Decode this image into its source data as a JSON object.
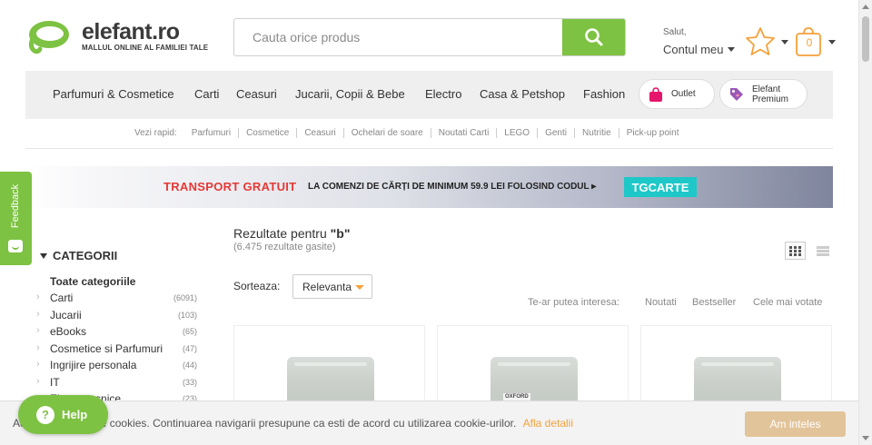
{
  "header": {
    "logo_text": "elefant.ro",
    "logo_tagline": "MALLUL ONLINE AL FAMILIEI TALE",
    "search_placeholder": "Cauta orice produs",
    "search_icon": "search-icon",
    "greeting": "Salut,",
    "account_label": "Contul meu",
    "favorites_icon": "star-icon",
    "cart_icon": "cart-icon",
    "cart_count": "0"
  },
  "nav": {
    "items": [
      "Parfumuri & Cosmetice",
      "Carti",
      "Ceasuri",
      "Jucarii, Copii & Bebe",
      "Electro",
      "Casa & Petshop",
      "Fashion"
    ],
    "outlet_label": "Outlet",
    "premium_label_1": "Elefant",
    "premium_label_2": "Premium"
  },
  "quick_links": {
    "label": "Vezi rapid:",
    "items": [
      "Parfumuri",
      "Cosmetice",
      "Ceasuri",
      "Ochelari de soare",
      "Noutati Carti",
      "LEGO",
      "Genti",
      "Nutritie",
      "Pick-up point"
    ]
  },
  "banner": {
    "headline": "TRANSPORT GRATUIT",
    "text": "LA COMENZI DE CĂRȚI DE MINIMUM 59.9 LEI FOLOSIND CODUL ▸",
    "code": "TGCARTE"
  },
  "feedback_label": "Feedback",
  "sidebar": {
    "title": "CATEGORII",
    "all_label": "Toate categoriile",
    "categories": [
      {
        "name": "Carti",
        "count": "(6091)"
      },
      {
        "name": "Jucarii",
        "count": "(103)"
      },
      {
        "name": "eBooks",
        "count": "(65)"
      },
      {
        "name": "Cosmetice si Parfumuri",
        "count": "(47)"
      },
      {
        "name": "Ingrijire personala",
        "count": "(44)"
      },
      {
        "name": "IT",
        "count": "(33)"
      },
      {
        "name": "Electrocasnice",
        "count": "(23)"
      }
    ]
  },
  "results": {
    "title_prefix": "Rezultate pentru ",
    "query": "\"b\"",
    "count": "(6.475 rezultate gasite)",
    "sort_label": "Sorteaza:",
    "sort_value": "Relevanta",
    "interest_label": "Te-ar putea interesa:",
    "interest_links": [
      "Noutati",
      "Bestseller",
      "Cele mai votate"
    ]
  },
  "products": [
    {
      "label": ""
    },
    {
      "label": "OXFORD"
    },
    {
      "label": ""
    }
  ],
  "cookie": {
    "text": "Acest site foloseste cookies. Continuarea navigarii presupune ca esti de acord cu utilizarea cookie-urilor.",
    "link": "Afla detalii",
    "button": "Am inteles"
  },
  "help_label": "Help",
  "colors": {
    "brand_green": "#7dc242",
    "accent_orange": "#f5a13b",
    "banner_red": "#e53935",
    "code_teal": "#1ec8c8"
  }
}
